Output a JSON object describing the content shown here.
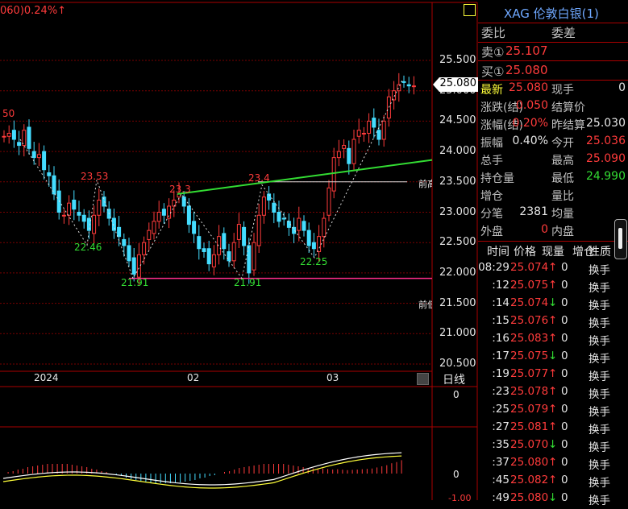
{
  "header": {
    "indicator_text": "060)0.24%↑",
    "square_icon": "square-icon"
  },
  "price_tag": "25.080",
  "axis": {
    "price_labels": [
      "25.500",
      "25.000",
      "24.500",
      "24.000",
      "23.500",
      "23.000",
      "22.500",
      "22.000",
      "21.500",
      "21.000",
      "20.500"
    ],
    "date_labels": [
      "2024",
      "02",
      "03"
    ],
    "period_label": "日线",
    "indicator_zero": [
      "0",
      "0"
    ],
    "indicator_bottom": "-1.00"
  },
  "annotations": {
    "high_labels": [
      "23.53",
      "23.3",
      "23.4",
      "50"
    ],
    "low_labels": [
      "22.46",
      "21.91",
      "21.91",
      "22.25"
    ],
    "prev_labels": [
      "前高",
      "前低"
    ]
  },
  "quote": {
    "title": "XAG 伦敦白银(1)",
    "weibi_label": "委比",
    "weicha_label": "委差",
    "sell_label": "卖①",
    "sell_value": "25.107",
    "buy_label": "买①",
    "buy_value": "25.080",
    "rows": [
      {
        "l1": "最新",
        "v1": "25.080",
        "l2": "现手",
        "v2": "0"
      },
      {
        "l1": "涨跌(结)",
        "v1": "0.050",
        "l2": "结算价",
        "v2": ""
      },
      {
        "l1": "涨幅(结)",
        "v1": "0.20%",
        "l2": "昨结算",
        "v2": "25.030"
      },
      {
        "l1": "振幅",
        "v1": "0.40%",
        "l2": "今开",
        "v2": "25.036"
      },
      {
        "l1": "总手",
        "v1": "",
        "l2": "最高",
        "v2": "25.090"
      },
      {
        "l1": "持仓量",
        "v1": "",
        "l2": "最低",
        "v2": "24.990"
      },
      {
        "l1": "增仓",
        "v1": "",
        "l2": "量比",
        "v2": ""
      },
      {
        "l1": "分笔",
        "v1": "2381",
        "l2": "均量",
        "v2": ""
      },
      {
        "l1": "外盘",
        "v1": "0",
        "l2": "内盘",
        "v2": ""
      }
    ]
  },
  "ticks": {
    "headers": [
      "时间",
      "价格",
      "现量",
      "增仓",
      "性质"
    ],
    "rows": [
      {
        "time": "08:29",
        "price": "25.074",
        "dir": "↑",
        "qty": "0",
        "type": "换手"
      },
      {
        "time": ":12",
        "price": "25.075",
        "dir": "↑",
        "qty": "0",
        "type": "换手"
      },
      {
        "time": ":14",
        "price": "25.074",
        "dir": "↓",
        "qty": "0",
        "type": "换手"
      },
      {
        "time": ":15",
        "price": "25.076",
        "dir": "↑",
        "qty": "0",
        "type": "换手"
      },
      {
        "time": ":16",
        "price": "25.083",
        "dir": "↑",
        "qty": "0",
        "type": "换手"
      },
      {
        "time": ":17",
        "price": "25.075",
        "dir": "↓",
        "qty": "0",
        "type": "换手"
      },
      {
        "time": ":19",
        "price": "25.077",
        "dir": "↑",
        "qty": "0",
        "type": "换手"
      },
      {
        "time": ":23",
        "price": "25.078",
        "dir": "↑",
        "qty": "0",
        "type": "换手"
      },
      {
        "time": ":25",
        "price": "25.079",
        "dir": "↑",
        "qty": "0",
        "type": "换手"
      },
      {
        "time": ":27",
        "price": "25.081",
        "dir": "↑",
        "qty": "0",
        "type": "换手"
      },
      {
        "time": ":35",
        "price": "25.070",
        "dir": "↓",
        "qty": "0",
        "type": "换手"
      },
      {
        "time": ":37",
        "price": "25.080",
        "dir": "↑",
        "qty": "0",
        "type": "换手"
      },
      {
        "time": ":45",
        "price": "25.082",
        "dir": "↑",
        "qty": "0",
        "type": "换手"
      },
      {
        "time": ":49",
        "price": "25.080",
        "dir": "↓",
        "qty": "0",
        "type": "换手"
      }
    ]
  },
  "colors": {
    "up": "#ff3b3b",
    "down": "#33ccff",
    "green": "#33dd33",
    "yellow": "#ffff3a",
    "grid": "#7a0000",
    "magenta": "#ff2e8a"
  }
}
